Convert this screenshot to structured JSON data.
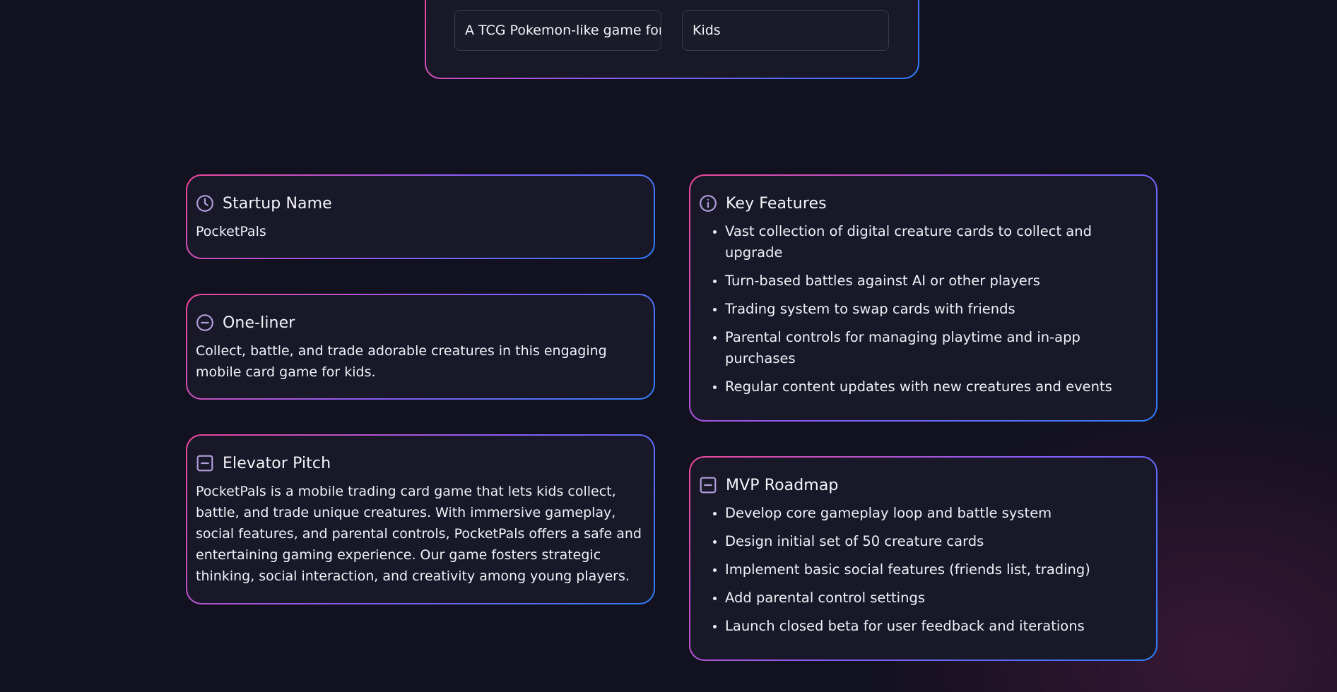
{
  "input_form": {
    "idea_value": "A TCG Pokemon-like game for kids",
    "audience_value": "Kids"
  },
  "accent_colors": {
    "gradient_start": "#ec4899",
    "gradient_mid": "#8b5cf6",
    "gradient_end": "#2f7df6",
    "icon": "#b39ddb"
  },
  "cards": {
    "startup_name": {
      "icon": "clock-icon",
      "title": "Startup Name",
      "text": "PocketPals"
    },
    "one_liner": {
      "icon": "minus-circle-icon",
      "title": "One-liner",
      "text": "Collect, battle, and trade adorable creatures in this engaging mobile card game for kids."
    },
    "elevator_pitch": {
      "icon": "minus-square-icon",
      "title": "Elevator Pitch",
      "text": "PocketPals is a mobile trading card game that lets kids collect, battle, and trade unique creatures. With immersive gameplay, social features, and parental controls, PocketPals offers a safe and entertaining gaming experience. Our game fosters strategic thinking, social interaction, and creativity among young players."
    },
    "key_features": {
      "icon": "info-icon",
      "title": "Key Features",
      "items": [
        "Vast collection of digital creature cards to collect and upgrade",
        "Turn-based battles against AI or other players",
        "Trading system to swap cards with friends",
        "Parental controls for managing playtime and in-app purchases",
        "Regular content updates with new creatures and events"
      ]
    },
    "mvp_roadmap": {
      "icon": "minus-square-icon",
      "title": "MVP Roadmap",
      "items": [
        "Develop core gameplay loop and battle system",
        "Design initial set of 50 creature cards",
        "Implement basic social features (friends list, trading)",
        "Add parental control settings",
        "Launch closed beta for user feedback and iterations"
      ]
    }
  }
}
